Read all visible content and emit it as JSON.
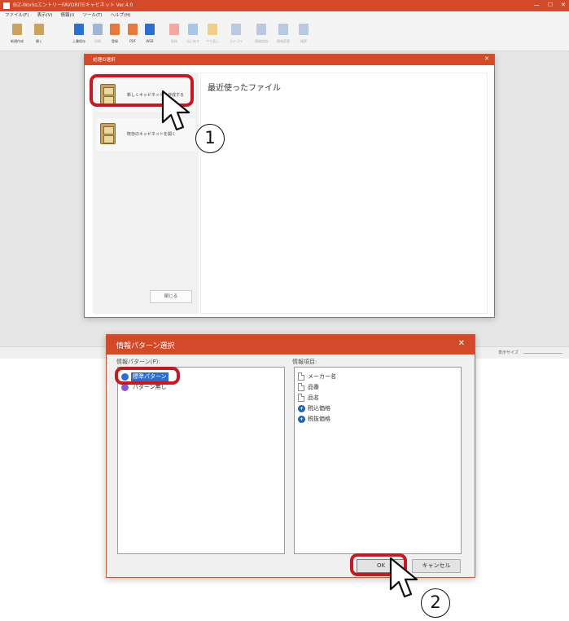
{
  "app": {
    "title": "BiZ-WorksエントリーFAVORITEキャビネット Ver.4.0",
    "menu": [
      "ファイル(F)",
      "表示(V)",
      "情報(I)",
      "ツール(T)",
      "ヘルプ(H)"
    ],
    "toolbar": [
      {
        "label": "新規作成",
        "icon": "new-icon",
        "color": "#c9a45e",
        "enabled": true
      },
      {
        "label": "開く",
        "icon": "open-icon",
        "color": "#c9a45e",
        "enabled": true
      },
      {
        "label": "上書保存",
        "icon": "save-icon",
        "color": "#2b6fd0",
        "enabled": true
      },
      {
        "label": "印刷",
        "icon": "print-icon",
        "color": "#9fb6d6",
        "enabled": false
      },
      {
        "label": "登録",
        "icon": "register-icon",
        "color": "#e67a3a",
        "enabled": true
      },
      {
        "label": "PDF",
        "icon": "pdf-icon",
        "color": "#e67a3a",
        "enabled": true
      },
      {
        "label": "WEB",
        "icon": "web-icon",
        "color": "#2b6fd0",
        "enabled": true
      },
      {
        "label": "削除",
        "icon": "delete-icon",
        "color": "#f2a8a0",
        "enabled": false
      },
      {
        "label": "元に戻す",
        "icon": "undo-icon",
        "color": "#a8c6e6",
        "enabled": false
      },
      {
        "label": "やり直し",
        "icon": "redo-icon",
        "color": "#f0cf8a",
        "enabled": false
      },
      {
        "label": "カテゴリ",
        "icon": "category-icon",
        "color": "#b9c9df",
        "enabled": false
      },
      {
        "label": "情報追加",
        "icon": "info-add-icon",
        "color": "#b9c9df",
        "enabled": false
      },
      {
        "label": "情報変更",
        "icon": "info-edit-icon",
        "color": "#b9c9df",
        "enabled": false
      },
      {
        "label": "検索",
        "icon": "search-icon",
        "color": "#b9c9df",
        "enabled": false
      }
    ],
    "status": {
      "zoom_label": "表示サイズ"
    }
  },
  "dialog1": {
    "title": "処理の選択",
    "options": [
      {
        "label": "新しくキャビネットを作成する"
      },
      {
        "label": "既存のキャビネットを開く"
      }
    ],
    "close_label": "閉じる",
    "recent_title": "最近使ったファイル"
  },
  "dialog2": {
    "title": "情報パターン選択",
    "patterns_label": "情報パターン(P):",
    "fields_label": "情報項目:",
    "patterns": [
      {
        "label": "標準パターン",
        "selected": true,
        "color": "#2a6fd0"
      },
      {
        "label": "パターン無し",
        "selected": false,
        "color": "#8b5bc4"
      }
    ],
    "fields": [
      {
        "label": "メーカー名",
        "icon": "document-icon"
      },
      {
        "label": "品番",
        "icon": "document-icon"
      },
      {
        "label": "品名",
        "icon": "document-icon"
      },
      {
        "label": "税込価格",
        "icon": "calculator-icon"
      },
      {
        "label": "税抜価格",
        "icon": "calculator-icon"
      }
    ],
    "ok_label": "OK",
    "cancel_label": "キャンセル"
  },
  "callouts": [
    {
      "number": "1",
      "target": "新しくキャビネットを作成する"
    },
    {
      "number": "2",
      "target": "OK"
    }
  ],
  "colors": {
    "accent": "#d24a2a",
    "highlight": "#c41a24",
    "selection": "#2a6fd0"
  }
}
